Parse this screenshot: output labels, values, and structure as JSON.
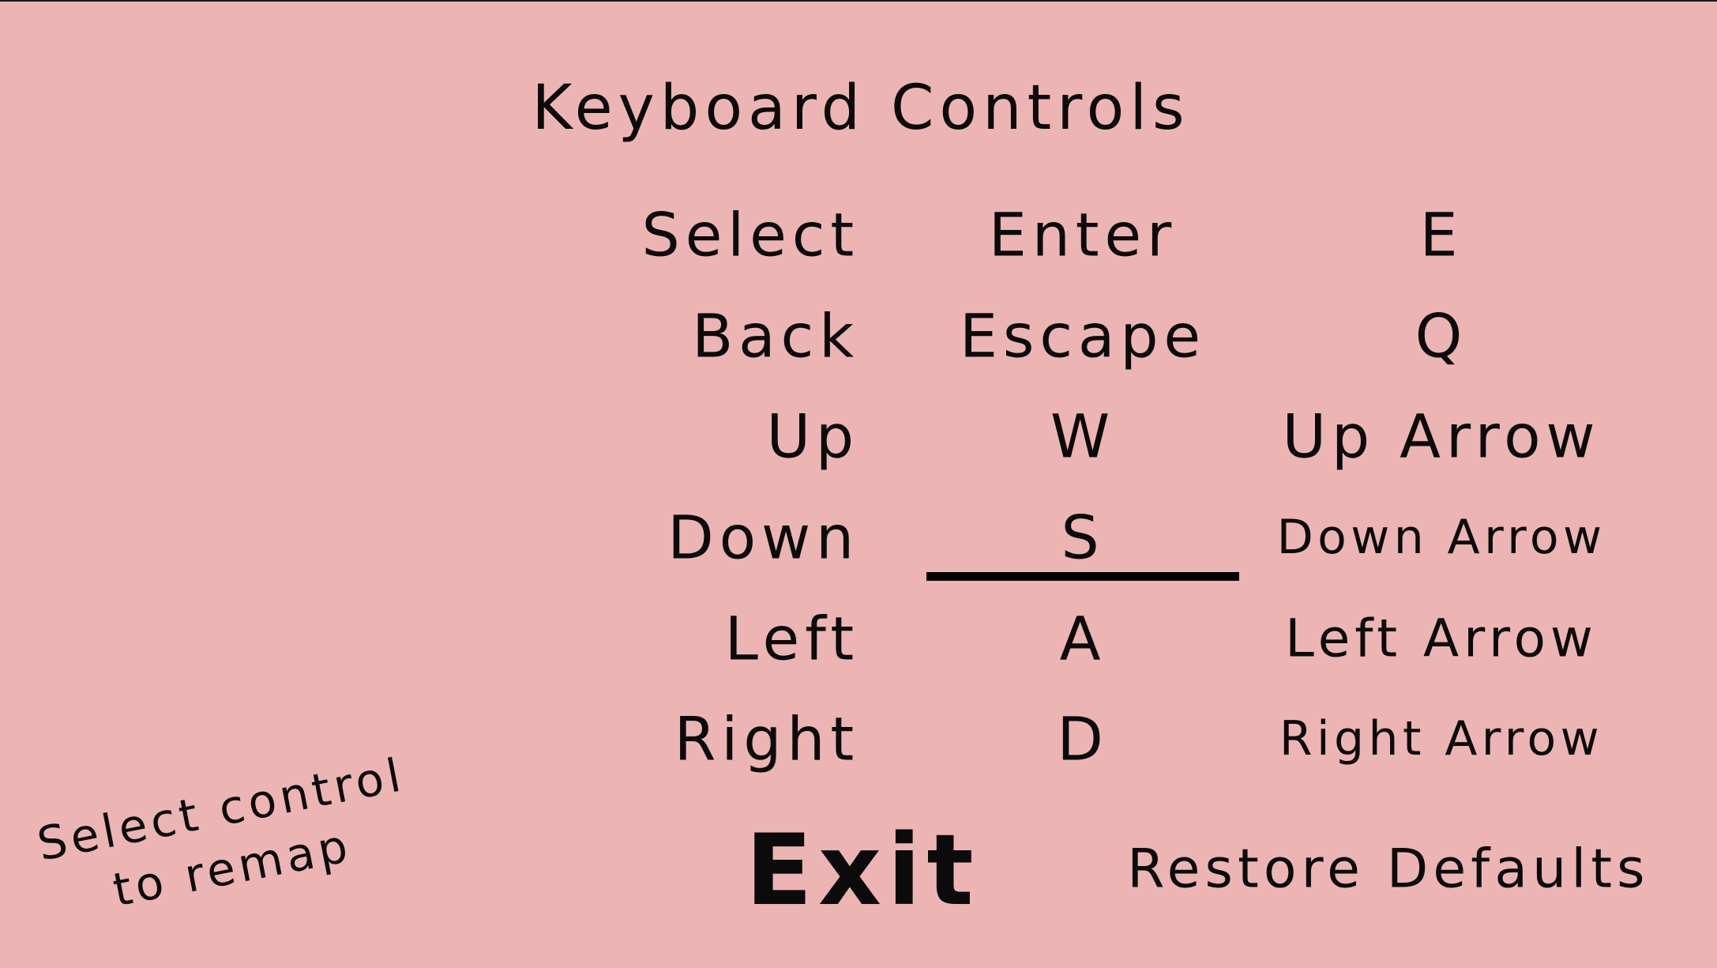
{
  "title": "Keyboard Controls",
  "controls": [
    {
      "action": "Select",
      "primary": "Enter",
      "secondary": "E"
    },
    {
      "action": "Back",
      "primary": "Escape",
      "secondary": "Q"
    },
    {
      "action": "Up",
      "primary": "W",
      "secondary": "Up Arrow"
    },
    {
      "action": "Down",
      "primary": "S",
      "secondary": "Down Arrow"
    },
    {
      "action": "Left",
      "primary": "A",
      "secondary": "Left Arrow"
    },
    {
      "action": "Right",
      "primary": "D",
      "secondary": "Right Arrow"
    }
  ],
  "selected": {
    "action": "Down",
    "column": "primary"
  },
  "buttons": {
    "exit": "Exit",
    "restore": "Restore Defaults"
  },
  "hint": {
    "line1": "Select control",
    "line2": "to remap"
  },
  "colors": {
    "background": "#ecb5b4",
    "text": "#0b0b0b"
  }
}
